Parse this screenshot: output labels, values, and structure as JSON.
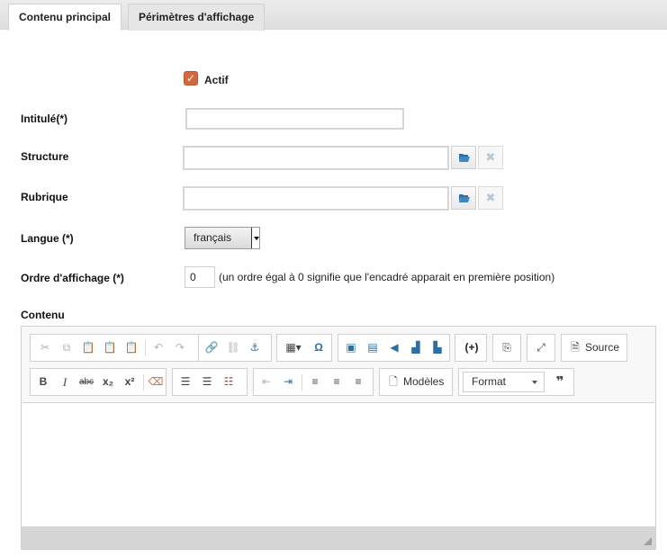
{
  "tabs": [
    {
      "label": "Contenu principal",
      "active": true
    },
    {
      "label": "Périmètres d'affichage",
      "active": false
    }
  ],
  "form": {
    "actif_label": "Actif",
    "actif_checked": true,
    "intitule_label": "Intitulé(*)",
    "intitule_value": "",
    "structure_label": "Structure",
    "structure_value": "",
    "rubrique_label": "Rubrique",
    "rubrique_value": "",
    "langue_label": "Langue (*)",
    "langue_value": "français",
    "ordre_label": "Ordre d'affichage (*)",
    "ordre_value": "0",
    "ordre_hint": "(un ordre égal à 0 signifie que l'encadré apparait en première position)",
    "contenu_label": "Contenu"
  },
  "editor": {
    "source_label": "Source",
    "templates_label": "Modèles",
    "format_label": "Format",
    "bold": "B",
    "italic": "I",
    "strike": "abc",
    "subscript": "x₂",
    "superscript": "x²",
    "special_char": "Ω",
    "quote": "❞",
    "placeholder_btn": "(+)"
  },
  "colors": {
    "accent": "#d5683f",
    "icon_blue": "#2c6fa6",
    "disabled": "#b3b3b3"
  }
}
